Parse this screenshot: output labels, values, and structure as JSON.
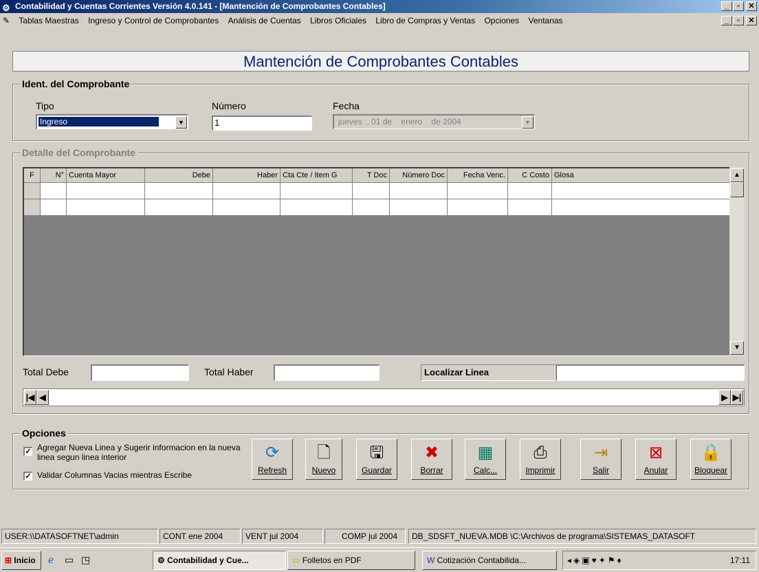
{
  "window": {
    "title": "Contabilidad y Cuentas Corrientes  Versión 4.0.141 - [Mantención de Comprobantes Contables]",
    "controls": [
      "_",
      "□",
      "X"
    ]
  },
  "menu": {
    "items": [
      "Tablas Maestras",
      "Ingreso y Control de Comprobantes",
      "Análisis de Cuentas",
      "Libros Oficiales",
      "Libro de Compras y Ventas",
      "Opciones",
      "Ventanas"
    ]
  },
  "form": {
    "title": "Mantención de Comprobantes Contables"
  },
  "ident": {
    "group_title": "Ident. del Comprobante",
    "tipo_label": "Tipo",
    "tipo_value": "Ingreso",
    "numero_label": "Número",
    "numero_value": "1",
    "fecha_label": "Fecha",
    "fecha_value": "jueves  , 01 de    enero    de 2004"
  },
  "detalle": {
    "group_title": "Detalle del Comprobante",
    "columns": [
      "F",
      "N°",
      "Cuenta Mayor",
      "Debe",
      "Haber",
      "Cta Cte / Item G",
      "T Doc",
      "Número Doc",
      "Fecha Venc.",
      "C Costo",
      "Glosa"
    ]
  },
  "totals": {
    "debe_label": "Total Debe",
    "haber_label": "Total Haber",
    "localizar_label": "Localizar Linea"
  },
  "opciones": {
    "group_title": "Opciones",
    "check1": "Agregar Nueva Linea y Sugerir informacion en la nueva linea segun linea interior",
    "check2": "Validar Columnas Vacias mientras Escribe",
    "tools": [
      "Refresh",
      "Nuevo",
      "Guardar",
      "Borrar",
      "Calc...",
      "Imprimir",
      "Salir",
      "Anular",
      "Bloquear"
    ]
  },
  "status": {
    "user": "USER:\\\\DATASOFTNET\\admin",
    "cont": "CONT ene 2004",
    "vent": "VENT jul 2004",
    "comp": "COMP jul 2004",
    "db": "DB_SDSFT_NUEVA.MDB \\C:\\Archivos de programa\\SISTEMAS_DATASOFT"
  },
  "taskbar": {
    "start": "Inicio",
    "tasks": [
      "Contabilidad y Cue...",
      "Folletos en PDF",
      "Cotización Contabilida..."
    ],
    "clock": "17:11"
  },
  "colors": {
    "title_start": "#0a246a",
    "title_end": "#a6caf0",
    "highlight": "#0a246a"
  }
}
